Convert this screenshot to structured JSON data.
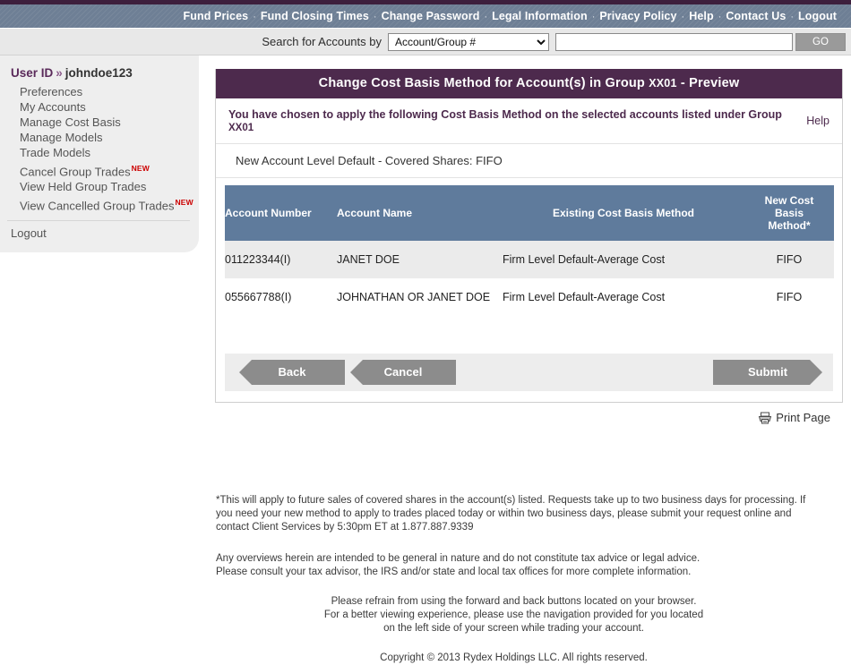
{
  "nav": {
    "separator": "·",
    "links": [
      {
        "label": "Fund Prices",
        "name": "nav-fund-prices"
      },
      {
        "label": "Fund Closing Times",
        "name": "nav-fund-closing-times"
      },
      {
        "label": "Change Password",
        "name": "nav-change-password"
      },
      {
        "label": "Legal Information",
        "name": "nav-legal-information"
      },
      {
        "label": "Privacy Policy",
        "name": "nav-privacy-policy"
      },
      {
        "label": "Help",
        "name": "nav-help"
      },
      {
        "label": "Contact Us",
        "name": "nav-contact-us"
      },
      {
        "label": "Logout",
        "name": "nav-logout"
      }
    ]
  },
  "search": {
    "label": "Search for Accounts by",
    "selected_option": "Account/Group #",
    "options": [
      "Account/Group #"
    ],
    "input_value": "",
    "input_placeholder": "",
    "go_label": "GO"
  },
  "sidebar": {
    "user_id_label": "User ID",
    "chevron": "»",
    "user_id_value": "johndoe123",
    "items": [
      {
        "label": "Preferences",
        "badge": ""
      },
      {
        "label": "My Accounts",
        "badge": ""
      },
      {
        "label": "Manage Cost Basis",
        "badge": ""
      },
      {
        "label": "Manage Models",
        "badge": ""
      },
      {
        "label": "Trade Models",
        "badge": ""
      },
      {
        "label": "Cancel Group Trades",
        "badge": "NEW"
      },
      {
        "label": "View Held Group Trades",
        "badge": ""
      },
      {
        "label": "View Cancelled Group Trades",
        "badge": "NEW"
      }
    ],
    "logout_label": "Logout"
  },
  "panel": {
    "title_main": "Change Cost Basis Method for Account(s) in Group ",
    "title_group": "XX01",
    "title_suffix": " - Preview",
    "intro_text": "You have chosen to apply the following Cost Basis Method on the selected accounts listed under Group ",
    "intro_group": "XX01",
    "help_label": "Help",
    "method_line": "New Account Level Default - Covered Shares: FIFO"
  },
  "table": {
    "columns": [
      "Account Number",
      "Account Name",
      "Existing Cost Basis Method",
      "New Cost Basis Method*"
    ],
    "column_new_line1": "New Cost",
    "column_new_line2": "Basis",
    "column_new_line3": "Method*",
    "rows": [
      {
        "account_number": "011223344(I)",
        "account_name": "JANET DOE",
        "existing_method": "Firm Level Default-Average Cost",
        "new_method": "FIFO"
      },
      {
        "account_number": "055667788(I)",
        "account_name": "JOHNATHAN OR JANET DOE",
        "existing_method": "Firm Level Default-Average Cost",
        "new_method": "FIFO"
      }
    ]
  },
  "buttons": {
    "back": "Back",
    "cancel": "Cancel",
    "submit": "Submit"
  },
  "print": {
    "label": "Print Page"
  },
  "footnotes": {
    "star_note": "*This will apply to future sales of covered shares in the account(s) listed. Requests take up to two business days for processing. If you need your new method to apply to trades placed today or within two business days, please submit your request online and contact Client Services by 5:30pm ET at 1.877.887.9339",
    "tax_note_line1": "Any overviews herein are intended to be general in nature and do not constitute tax advice or legal advice.",
    "tax_note_line2": "Please consult your tax advisor, the IRS and/or state and local tax offices for more complete information.",
    "nav_note_line1": "Please refrain from using the forward and back buttons located on your browser.",
    "nav_note_line2": "For a better viewing experience, please use the navigation provided for you located",
    "nav_note_line3": "on the left side of your screen while trading your account.",
    "copyright": "Copyright © 2013 Rydex Holdings LLC. All rights reserved."
  },
  "colors": {
    "brand_purple": "#4d2a4d",
    "nav_blue": "#6e7f95",
    "table_header_blue": "#5f7b9c",
    "new_badge_red": "#cc0000",
    "fifo_green": "#0a7a0a"
  }
}
